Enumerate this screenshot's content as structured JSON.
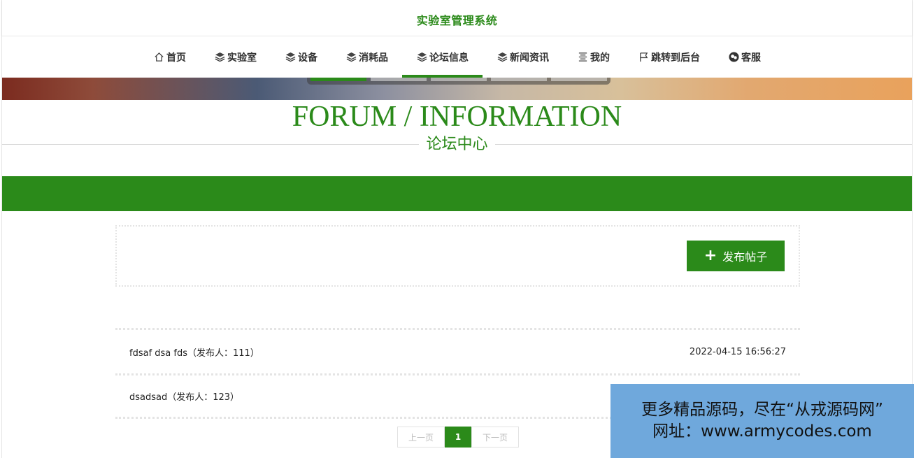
{
  "site": {
    "title": "实验室管理系统"
  },
  "nav": {
    "items": [
      {
        "label": "首页",
        "icon": "home-icon",
        "active": false
      },
      {
        "label": "实验室",
        "icon": "layers-icon",
        "active": false
      },
      {
        "label": "设备",
        "icon": "layers-icon",
        "active": false
      },
      {
        "label": "消耗品",
        "icon": "layers-icon",
        "active": false
      },
      {
        "label": "论坛信息",
        "icon": "layers-icon",
        "active": true
      },
      {
        "label": "新闻资讯",
        "icon": "layers-icon",
        "active": false
      },
      {
        "label": "我的",
        "icon": "list-icon",
        "active": false
      },
      {
        "label": "跳转到后台",
        "icon": "flag-icon",
        "active": false
      },
      {
        "label": "客服",
        "icon": "chat-icon",
        "active": false
      }
    ]
  },
  "colors": {
    "accent": "#2b8a1a",
    "watermark_bg": "#6fa8dc"
  },
  "heading": {
    "en": "FORUM / INFORMATION",
    "cn": "论坛中心"
  },
  "toolbar": {
    "publish_label": "发布帖子",
    "publish_icon": "plus-icon"
  },
  "posts": [
    {
      "title": "fdsaf dsa fds（发布人：111）",
      "date": "2022-04-15 16:56:27"
    },
    {
      "title": "dsadsad（发布人：123）",
      "date": ""
    }
  ],
  "pager": {
    "prev": "上一页",
    "current": "1",
    "next": "下一页"
  },
  "watermark": {
    "line1": "更多精品源码，尽在“从戎源码网”",
    "line2": "网址：www.armycodes.com"
  }
}
